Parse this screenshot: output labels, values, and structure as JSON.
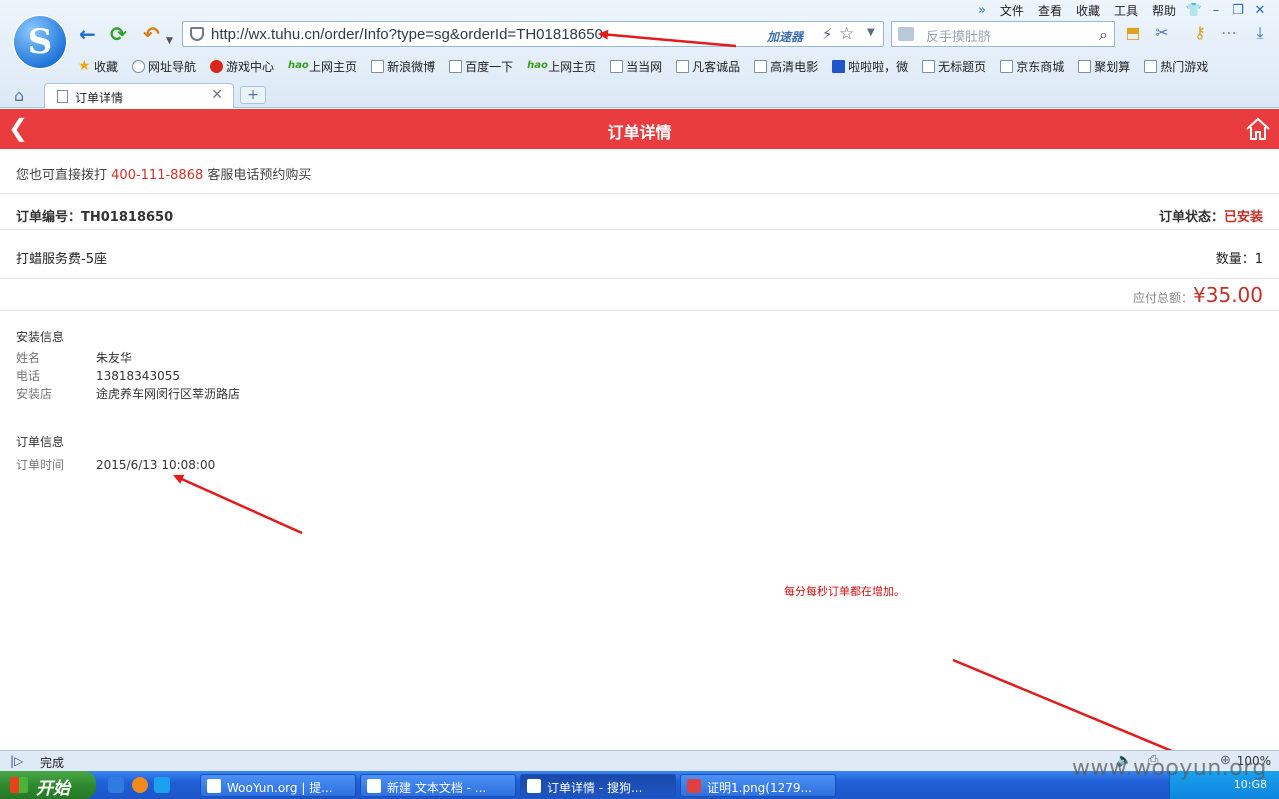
{
  "browser": {
    "menu": [
      "文件",
      "查看",
      "收藏",
      "工具",
      "帮助"
    ],
    "url": "http://wx.tuhu.cn/order/Info?type=sg&orderId=TH01818650",
    "accelerator_label": "加速器",
    "search_placeholder": "反手摸肚脐",
    "bookmarks": [
      "收藏",
      "网址导航",
      "游戏中心",
      "上网主页",
      "新浪微博",
      "百度一下",
      "上网主页",
      "当当网",
      "凡客诚品",
      "高清电影",
      "啦啦啦，微",
      "无标题页",
      "京东商城",
      "聚划算",
      "热门游戏"
    ],
    "tab_title": "订单详情",
    "status_text": "完成",
    "zoom": "100%"
  },
  "page": {
    "title": "订单详情",
    "notice_prefix": "您也可直接拨打",
    "phone": "400-111-8868",
    "notice_suffix": "客服电话预约购买",
    "order_no_label": "订单编号：",
    "order_no": "TH01818650",
    "status_label": "订单状态：",
    "status": "已安装",
    "item_name": "打蜡服务费-5座",
    "qty_label": "数量：",
    "qty": "1",
    "total_label": "应付总额：",
    "total": "¥35.00",
    "install_section": "安装信息",
    "name_label": "姓名",
    "name": "朱友华",
    "tel_label": "电话",
    "tel": "13818343055",
    "store_label": "安装店",
    "store": "途虎养车网闵行区莘沥路店",
    "order_section": "订单信息",
    "time_label": "订单时间",
    "time": "2015/6/13 10:08:00",
    "annotation": "每分每秒订单都在增加。"
  },
  "taskbar": {
    "start": "开始",
    "tasks": [
      "WooYun.org | 提...",
      "新建 文本文档 - ...",
      "订单详情 - 搜狗...",
      "证明1.png(1279..."
    ],
    "clock": "10:G8"
  },
  "watermark": "www.wooyun.org",
  "colors": {
    "header_red": "#e83c3f",
    "price_red": "#c3302a",
    "annotation_red": "#d01010"
  }
}
